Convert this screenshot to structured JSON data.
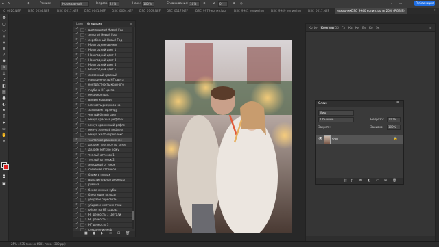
{
  "options_bar": {
    "mode_label": "Режим:",
    "mode_value": "Нормальный",
    "opacity_label": "Непрозр.:",
    "opacity_value": "22%",
    "press_label": "Наж.:",
    "press_value": "100%",
    "smoothing_label": "Сглаживание:",
    "smoothing_value": "10%",
    "angle_value": "0°",
    "publish_label": "Публикация"
  },
  "tabs": [
    "_C_0020.NEF",
    "DSC_0034.NEF",
    "DSC_0017.NEF",
    "DSC_0041.NEF",
    "DSC_0064.NEF",
    "DSC_0109.NEF",
    "DSC_0117.NEF",
    "DSC_9979 копия.jpg",
    "DSC_9941 копия.jpg",
    "DSC_9949 копия.jpg",
    "DSC_0017.NEF",
    "исходникDSC_9940 копия.jpg @ 25% (RGB/8)"
  ],
  "actions_panel": {
    "tab_history": "Цвет",
    "tab_actions": "Операции",
    "items": [
      "шоколадный Новый Год",
      "золотой Новый Год",
      "серебряный Новый Год",
      "Новогодние свечки",
      "Новогодний цвет 1",
      "Новогодний цвет 2",
      "Новогодний цвет 3",
      "Новогодний цвет 4",
      "Новогодний цвет 5",
      "сказочный красный",
      "насыщенность НГ цвета",
      "контрастность красного",
      "глубина НГ цвета",
      "микроконтраст",
      "виньетирование",
      "мягкость рисунков на",
      "зажигаем гирлянду",
      "чистый белый цвет",
      "минус красный рефлекс",
      "минус оранжевый рефле",
      "минус зеленый рефлекс",
      "минус желтый рефлекс",
      "частотное разложение",
      "делаем текстуру на коже",
      "делаем мягкую кожу",
      "теплый оттенок 1",
      "теплый оттенок 2",
      "холодный оттенок",
      "свечение оттенков",
      "блики в глазах",
      "выразительные ресницы",
      "румяна",
      "белоснежные зубы",
      "блестящие волосы",
      "убираем пересветы",
      "убираем жесткие тени",
      "объем на НГ кадрах",
      "НГ резкость 1 (детали",
      "НГ резкость 2",
      "НГ резкость 3",
      "сохранение web"
    ],
    "selected_index": 22,
    "scroll_fraction": 0.95
  },
  "paths_panel": {
    "tabs": [
      "Ко",
      "Ин",
      "Контуры",
      "Об",
      "Гл",
      "Ка",
      "Ки",
      "Бу",
      "Ко",
      "Эк"
    ],
    "active_tab": "Контуры"
  },
  "layers_panel": {
    "title": "Слои",
    "filter_label": "Вид",
    "blend_value": "Обычные",
    "opacity_label": "Непрозр.:",
    "opacity_value": "100%",
    "lock_label": "Закреп.:",
    "fill_label": "Заливка:",
    "fill_value": "100%",
    "layer_name": "Фон"
  },
  "status_bar": {
    "text": "25%   4935 пикс. x 6501 пикс. (300 ppi)"
  },
  "colors": {
    "foreground": "#111111",
    "background": "#e02020",
    "accent": "#1f6fe5"
  }
}
